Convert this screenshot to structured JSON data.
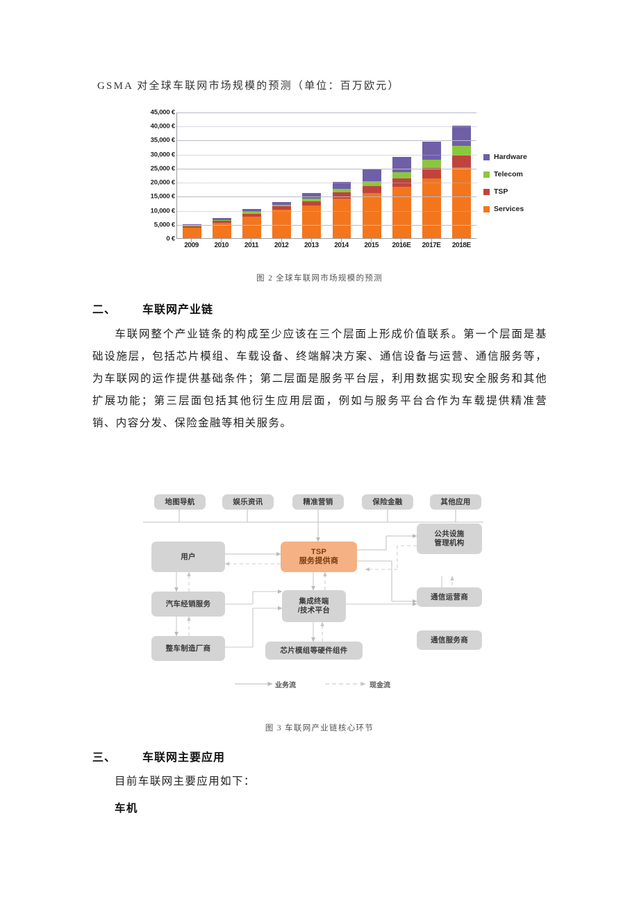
{
  "document": {
    "title_line": "GSMA 对全球车联网市场规模的预测（单位：百万欧元）",
    "figure2_caption": "图 2 全球车联网市场规模的预测",
    "figure3_caption": "图 3 车联网产业链核心环节",
    "section2": {
      "number": "二、",
      "title": "车联网产业链"
    },
    "section3": {
      "number": "三、",
      "title": "车联网主要应用"
    },
    "paragraph1": "车联网整个产业链条的构成至少应该在三个层面上形成价值联系。第一个层面是基础设施层，包括芯片模组、车载设备、终端解决方案、通信设备与运营、通信服务等，为车联网的运作提供基础条件；第二层面是服务平台层，利用数据实现安全服务和其他扩展功能；第三层面包括其他衍生应用层面，例如与服务平台合作为车载提供精准营销、内容分发、保险金融等相关服务。",
    "lead_in": "目前车联网主要应用如下：",
    "app_item_1": "车机"
  },
  "chart_data": {
    "type": "bar",
    "stacked": true,
    "title": "GSMA 对全球车联网市场规模的预测（单位：百万欧元）",
    "xlabel": "",
    "ylabel": "",
    "ylim": [
      0,
      45000
    ],
    "ytick_step": 5000,
    "ytick_labels": [
      "45,000 €",
      "40,000 €",
      "35,000 €",
      "30,000 €",
      "25,000 €",
      "20,000 €",
      "15,000 €",
      "10,000 €",
      "5,000 €",
      "0 €"
    ],
    "grid": true,
    "legend_position": "right",
    "categories": [
      "2009",
      "2010",
      "2011",
      "2012",
      "2013",
      "2014",
      "2015",
      "2016E",
      "2017E",
      "2018E"
    ],
    "series": [
      {
        "name": "Services",
        "color": "#f3761d",
        "values": [
          3700,
          5400,
          7600,
          10200,
          11600,
          14200,
          16000,
          18200,
          21200,
          25200
        ]
      },
      {
        "name": "TSP",
        "color": "#c0443d",
        "values": [
          500,
          700,
          1100,
          1200,
          1500,
          2100,
          2600,
          3100,
          3700,
          4300
        ]
      },
      {
        "name": "Telecom",
        "color": "#8cc63e",
        "values": [
          300,
          400,
          700,
          500,
          900,
          1300,
          1800,
          2200,
          3000,
          3400
        ]
      },
      {
        "name": "Hardware",
        "color": "#6f5fa8",
        "values": [
          400,
          600,
          900,
          900,
          2000,
          2500,
          4000,
          5500,
          6600,
          7100
        ]
      }
    ],
    "totals": [
      4900,
      7100,
      10300,
      12800,
      16000,
      20100,
      24400,
      29000,
      34500,
      40000
    ]
  },
  "diagram": {
    "top_row": [
      "地图导航",
      "娱乐资讯",
      "精准营销",
      "保险金融",
      "其他应用"
    ],
    "center": {
      "line1": "TSP",
      "line2": "服务提供商"
    },
    "left": [
      "用户",
      "汽车经销服务",
      "整车制造厂商"
    ],
    "right": [
      "公共设施\n管理机构",
      "通信运营商",
      "通信服务商"
    ],
    "right_flat": [
      "公共设施管理机构",
      "通信运营商",
      "通信服务商"
    ],
    "middle": {
      "line1": "集成终端",
      "line2": "/技术平台"
    },
    "bottom": "芯片模组等硬件组件",
    "flow_legend": {
      "business": "业务流",
      "cash": "现金流"
    }
  }
}
